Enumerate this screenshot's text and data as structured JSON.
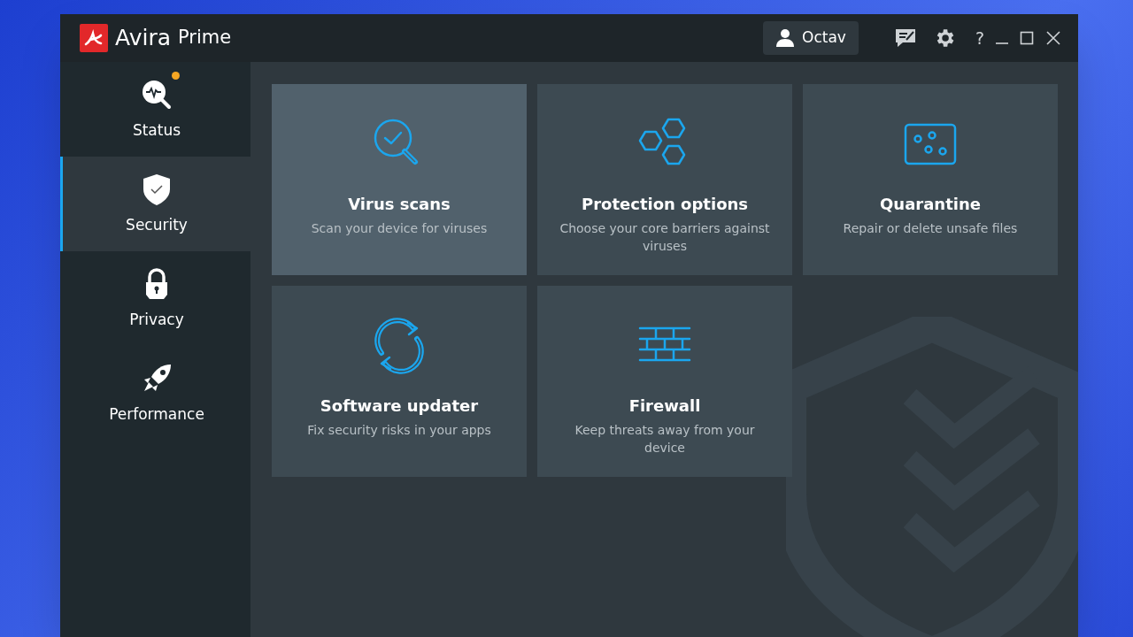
{
  "window": {
    "brand": "Avira",
    "product": "Prime"
  },
  "user": {
    "name": "Octav"
  },
  "help": "?",
  "sidebar": {
    "items": [
      {
        "label": "Status",
        "selected": false,
        "notification": true,
        "kind": "status"
      },
      {
        "label": "Security",
        "selected": true,
        "notification": false,
        "kind": "security"
      },
      {
        "label": "Privacy",
        "selected": false,
        "notification": false,
        "kind": "privacy"
      },
      {
        "label": "Performance",
        "selected": false,
        "notification": false,
        "kind": "performance"
      }
    ]
  },
  "tiles": [
    {
      "kind": "scan",
      "title": "Virus scans",
      "subtitle": "Scan your device for viruses",
      "selected": true
    },
    {
      "kind": "protection",
      "title": "Protection options",
      "subtitle": "Choose your core barriers against viruses",
      "selected": false
    },
    {
      "kind": "quarantine",
      "title": "Quarantine",
      "subtitle": "Repair or delete unsafe files",
      "selected": false
    },
    {
      "kind": "updater",
      "title": "Software updater",
      "subtitle": "Fix security risks in your apps",
      "selected": false
    },
    {
      "kind": "firewall",
      "title": "Firewall",
      "subtitle": "Keep threats away from your device",
      "selected": false
    }
  ]
}
